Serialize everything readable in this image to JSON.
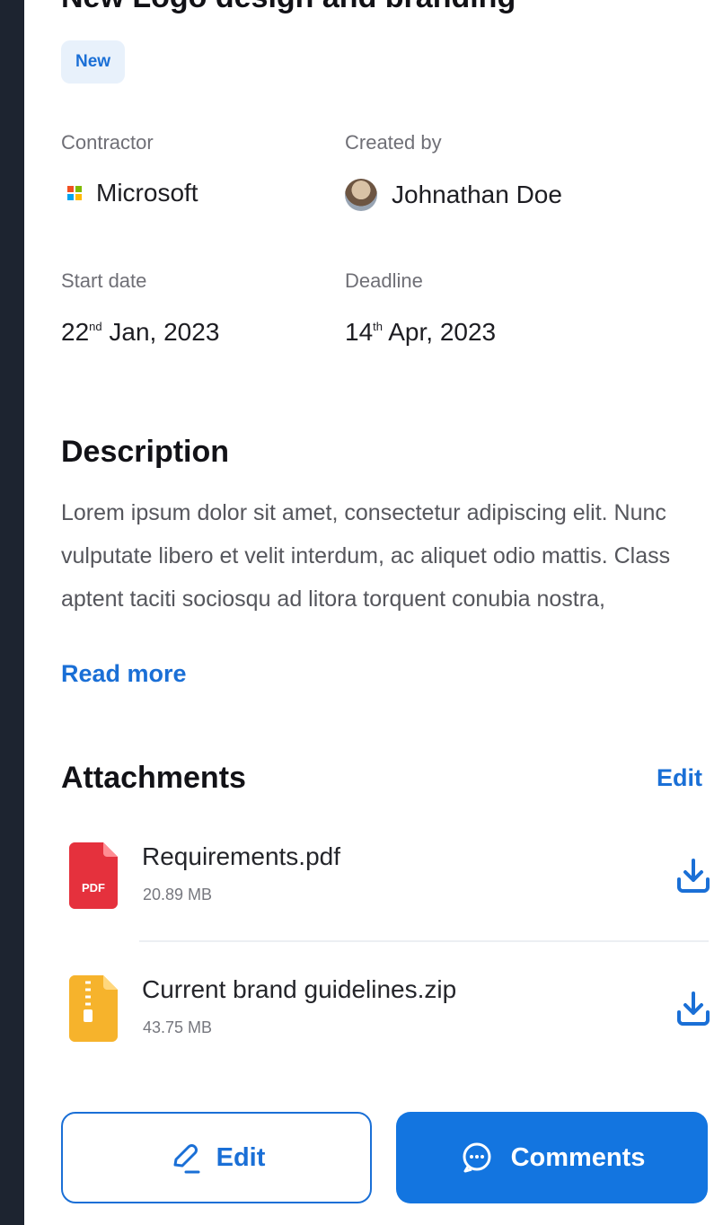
{
  "project": {
    "title": "New Logo design and branding",
    "status_badge": "New"
  },
  "details": {
    "contractor": {
      "label": "Contractor",
      "value": "Microsoft",
      "icon": "microsoft-logo"
    },
    "created_by": {
      "label": "Created by",
      "value": "Johnathan Doe",
      "icon": "avatar"
    },
    "start_date": {
      "label": "Start date",
      "day": "22",
      "suffix": "nd",
      "rest": " Jan, 2023"
    },
    "deadline": {
      "label": "Deadline",
      "day": "14",
      "suffix": "th",
      "rest": " Apr, 2023"
    }
  },
  "description": {
    "title": "Description",
    "text": "Lorem ipsum dolor sit amet, consectetur adipiscing elit. Nunc vulputate libero et velit interdum, ac aliquet odio mattis. Class aptent taciti sociosqu ad litora torquent  conubia nostra,",
    "read_more": "Read more"
  },
  "attachments": {
    "title": "Attachments",
    "edit_label": "Edit",
    "files": [
      {
        "name": "Requirements.pdf",
        "size": "20.89 MB",
        "type": "pdf",
        "icon_text": "PDF",
        "color": "#e5313d"
      },
      {
        "name": "Current brand guidelines.zip",
        "size": "43.75 MB",
        "type": "zip",
        "color": "#f6b32c"
      }
    ]
  },
  "actions": {
    "edit": "Edit",
    "comments": "Comments"
  },
  "colors": {
    "accent": "#1a6fd6",
    "button_primary": "#1375e0",
    "badge_bg": "#e8f1fb",
    "side_strip": "#1d2430"
  }
}
